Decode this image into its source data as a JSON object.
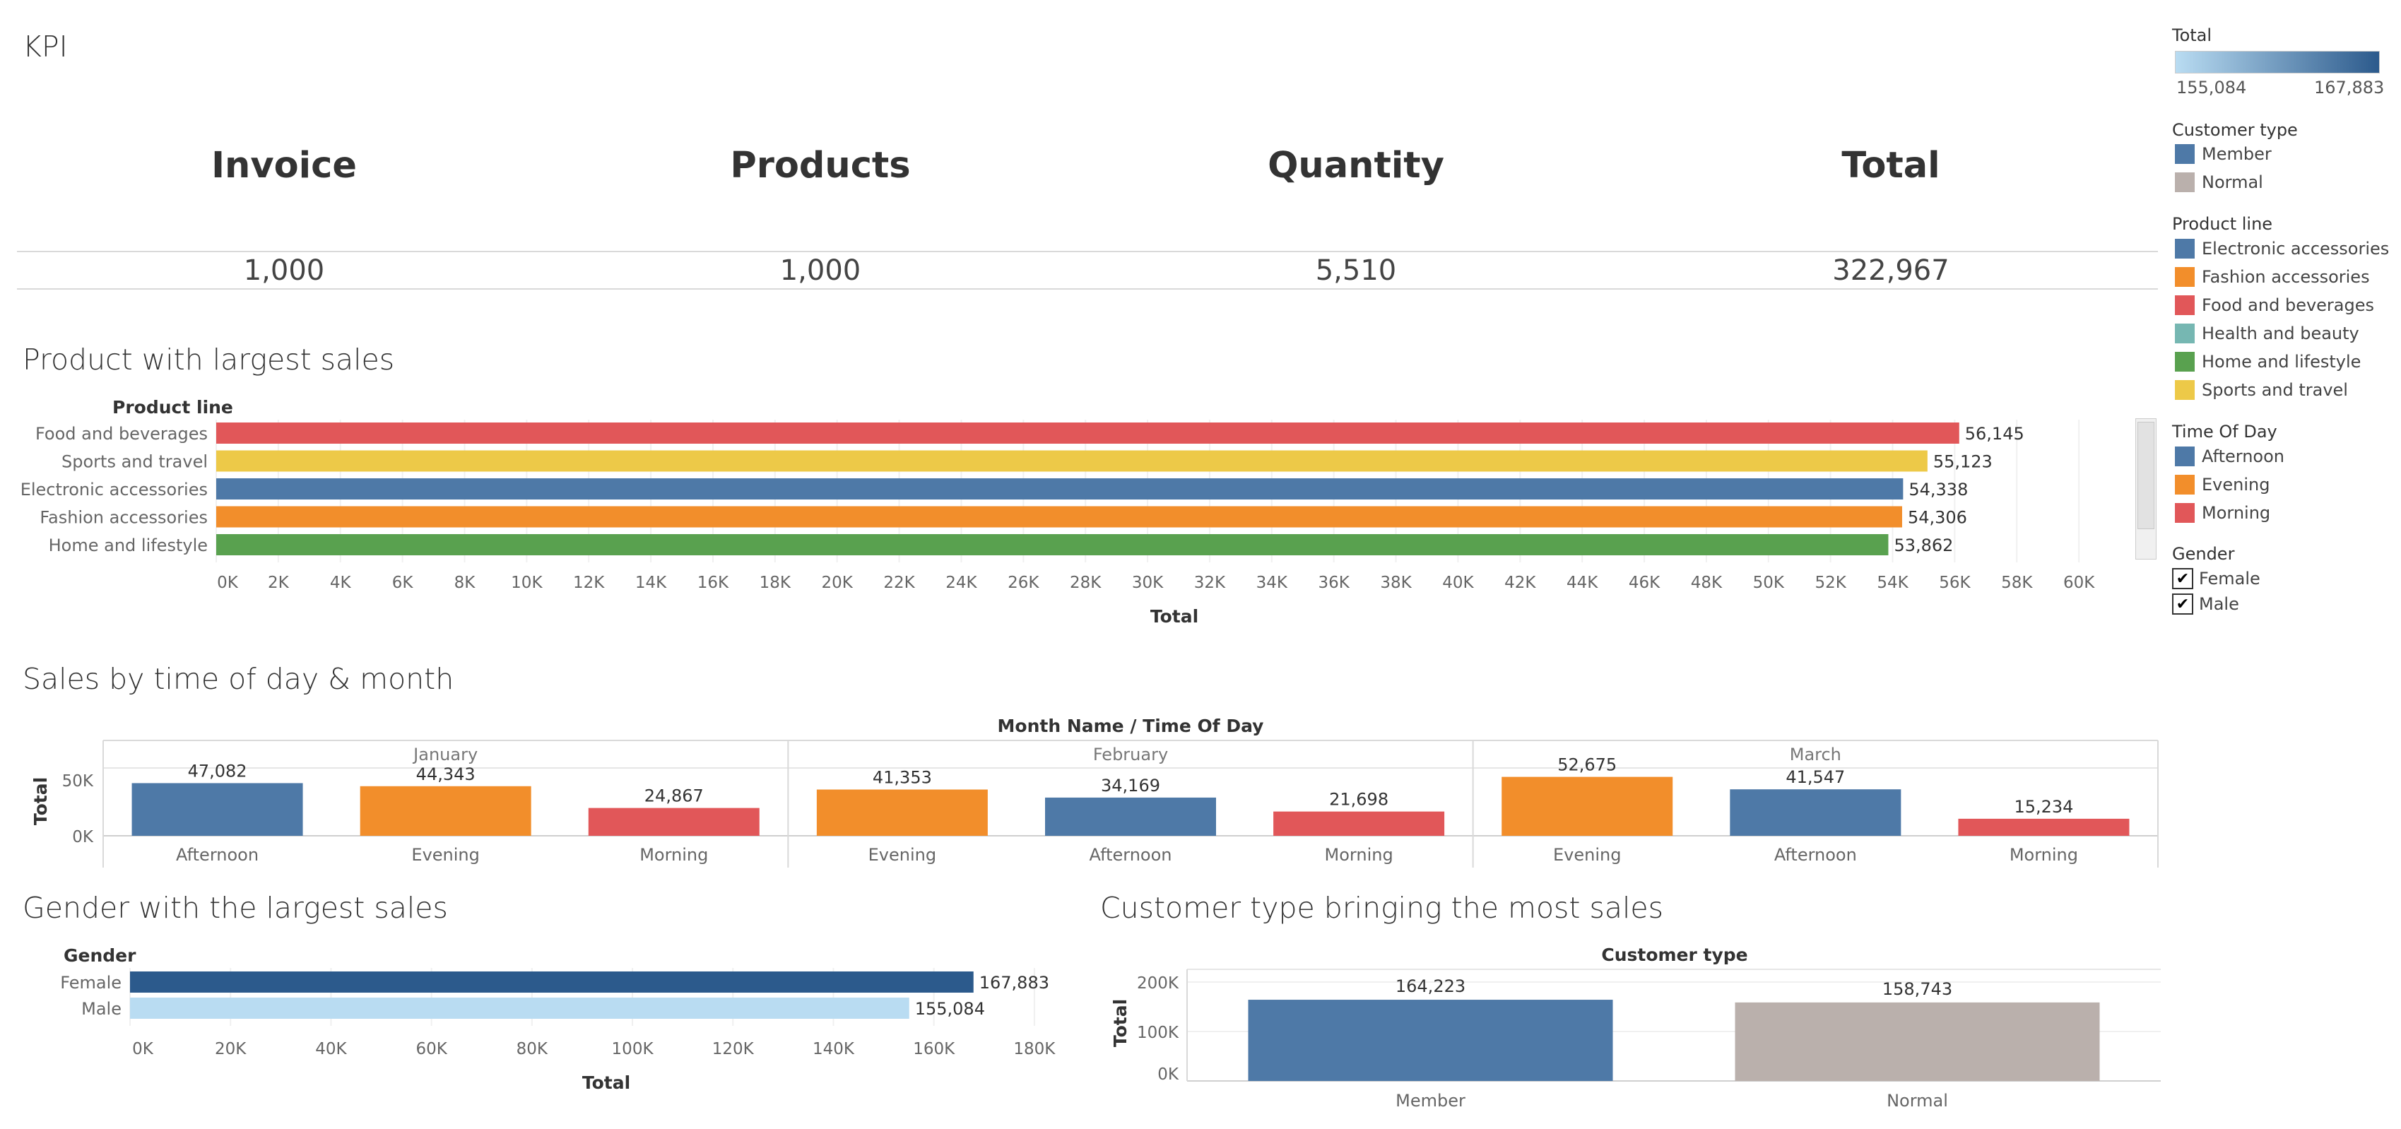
{
  "dashboard": {
    "kpi_title": "KPI",
    "kpis": [
      {
        "label": "Invoice",
        "value": "1,000"
      },
      {
        "label": "Products",
        "value": "1,000"
      },
      {
        "label": "Quantity",
        "value": "5,510"
      },
      {
        "label": "Total",
        "value": "322,967"
      }
    ],
    "section_titles": {
      "product": "Product with largest sales",
      "time": "Sales by time of day & month",
      "gender": "Gender with the largest sales",
      "customer": "Customer type bringing the most sales"
    }
  },
  "colors": {
    "food": "#e15759",
    "sports": "#edc948",
    "electronic": "#4e79a7",
    "fashion": "#f28e2b",
    "health": "#76b7b2",
    "home": "#59a14f",
    "member": "#4e79a7",
    "normal": "#bab0ac",
    "afternoon": "#4e79a7",
    "evening": "#f28e2b",
    "morning": "#e15759",
    "female": "#2c5a8c",
    "male": "#b9dcf2"
  },
  "legend": {
    "total_title": "Total",
    "total_min": "155,084",
    "total_max": "167,883",
    "customer_title": "Customer type",
    "customer_items": [
      "Member",
      "Normal"
    ],
    "product_title": "Product line",
    "product_items": [
      "Electronic accessories",
      "Fashion accessories",
      "Food and beverages",
      "Health and beauty",
      "Home and lifestyle",
      "Sports and travel"
    ],
    "time_title": "Time Of Day",
    "time_items": [
      "Afternoon",
      "Evening",
      "Morning"
    ],
    "gender_title": "Gender",
    "gender_items": [
      "Female",
      "Male"
    ]
  },
  "chart_data": [
    {
      "type": "bar",
      "orientation": "horizontal",
      "title": "Product with largest sales",
      "row_header": "Product line",
      "categories": [
        "Food and beverages",
        "Sports and travel",
        "Electronic accessories",
        "Fashion accessories",
        "Home and lifestyle"
      ],
      "values": [
        56145,
        55123,
        54338,
        54306,
        53862
      ],
      "value_labels": [
        "56,145",
        "55,123",
        "54,338",
        "54,306",
        "53,862"
      ],
      "color_keys": [
        "food",
        "sports",
        "electronic",
        "fashion",
        "home"
      ],
      "xlabel": "Total",
      "xlim": [
        0,
        62000
      ],
      "xticks": [
        0,
        2000,
        4000,
        6000,
        8000,
        10000,
        12000,
        14000,
        16000,
        18000,
        20000,
        22000,
        24000,
        26000,
        28000,
        30000,
        32000,
        34000,
        36000,
        38000,
        40000,
        42000,
        44000,
        46000,
        48000,
        50000,
        52000,
        54000,
        56000,
        58000,
        60000
      ],
      "xtick_labels": [
        "0K",
        "2K",
        "4K",
        "6K",
        "8K",
        "10K",
        "12K",
        "14K",
        "16K",
        "18K",
        "20K",
        "22K",
        "24K",
        "26K",
        "28K",
        "30K",
        "32K",
        "34K",
        "36K",
        "38K",
        "40K",
        "42K",
        "44K",
        "46K",
        "48K",
        "50K",
        "52K",
        "54K",
        "56K",
        "58K",
        "60K"
      ]
    },
    {
      "type": "bar",
      "title": "Sales by time of day & month",
      "header": "Month Name  /  Time Of Day",
      "ylabel": "Total",
      "ylim": [
        0,
        60000
      ],
      "yticks": [
        0,
        50000
      ],
      "ytick_labels": [
        "0K",
        "50K"
      ],
      "panels": [
        {
          "month": "January",
          "categories": [
            "Afternoon",
            "Evening",
            "Morning"
          ],
          "values": [
            47082,
            44343,
            24867
          ],
          "labels": [
            "47,082",
            "44,343",
            "24,867"
          ]
        },
        {
          "month": "February",
          "categories": [
            "Evening",
            "Afternoon",
            "Morning"
          ],
          "values": [
            41353,
            34169,
            21698
          ],
          "labels": [
            "41,353",
            "34,169",
            "21,698"
          ]
        },
        {
          "month": "March",
          "categories": [
            "Evening",
            "Afternoon",
            "Morning"
          ],
          "values": [
            52675,
            41547,
            15234
          ],
          "labels": [
            "52,675",
            "41,547",
            "15,234"
          ]
        }
      ]
    },
    {
      "type": "bar",
      "orientation": "horizontal",
      "title": "Gender with the largest sales",
      "row_header": "Gender",
      "categories": [
        "Female",
        "Male"
      ],
      "values": [
        167883,
        155084
      ],
      "value_labels": [
        "167,883",
        "155,084"
      ],
      "color_keys": [
        "female",
        "male"
      ],
      "xlabel": "Total",
      "xlim": [
        0,
        190000
      ],
      "xticks": [
        0,
        20000,
        40000,
        60000,
        80000,
        100000,
        120000,
        140000,
        160000,
        180000
      ],
      "xtick_labels": [
        "0K",
        "20K",
        "40K",
        "60K",
        "80K",
        "100K",
        "120K",
        "140K",
        "160K",
        "180K"
      ]
    },
    {
      "type": "bar",
      "title": "Customer type bringing the most sales",
      "header": "Customer type",
      "categories": [
        "Member",
        "Normal"
      ],
      "values": [
        164223,
        158743
      ],
      "value_labels": [
        "164,223",
        "158,743"
      ],
      "color_keys": [
        "member",
        "normal"
      ],
      "ylabel": "Total",
      "ylim": [
        0,
        200000
      ],
      "yticks": [
        0,
        100000,
        200000
      ],
      "ytick_labels": [
        "0K",
        "100K",
        "200K"
      ]
    }
  ]
}
